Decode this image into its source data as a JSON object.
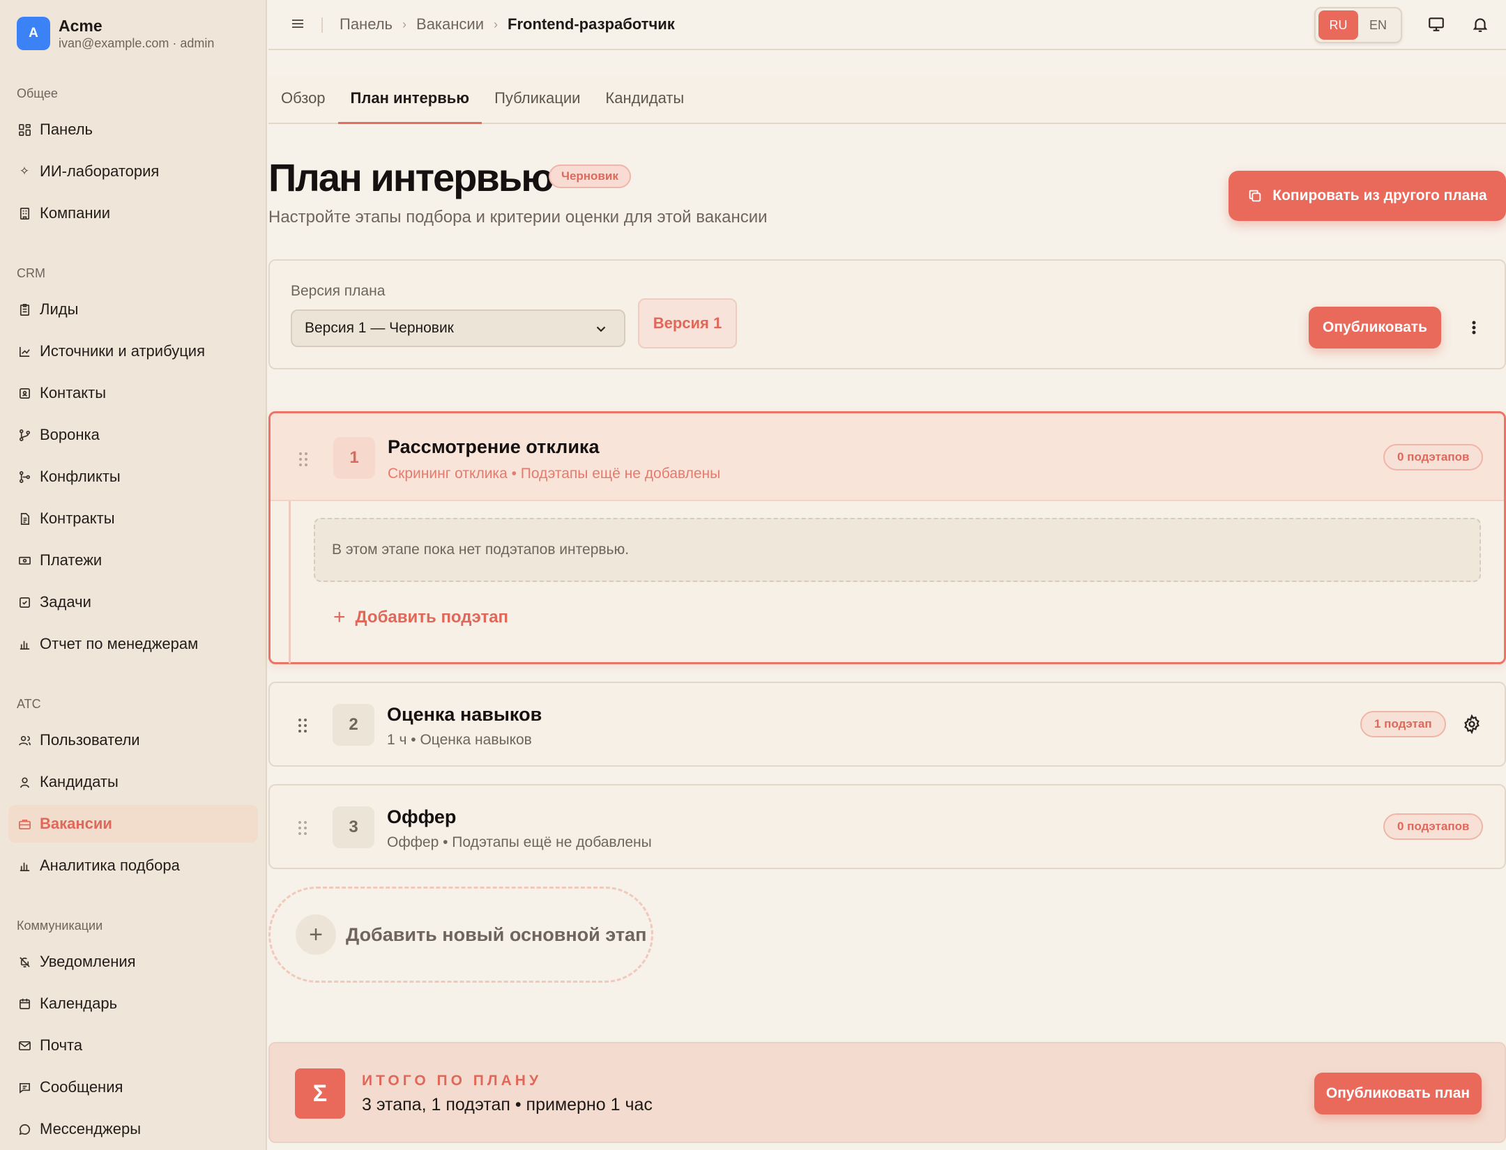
{
  "brand": {
    "initial": "A",
    "name": "Acme",
    "subtitle": "ivan@example.com · admin"
  },
  "sidebar": {
    "groups": [
      {
        "title": "Общее",
        "items": [
          {
            "label": "Панель",
            "icon": "dashboard-icon"
          },
          {
            "label": "ИИ-лаборатория",
            "icon": "sparkles-icon"
          },
          {
            "label": "Компании",
            "icon": "building-icon"
          }
        ]
      },
      {
        "title": "CRM",
        "items": [
          {
            "label": "Лиды",
            "icon": "clipboard-icon"
          },
          {
            "label": "Источники и атрибуция",
            "icon": "chart-line-icon"
          },
          {
            "label": "Контакты",
            "icon": "contact-card-icon"
          },
          {
            "label": "Воронка",
            "icon": "git-branch-icon"
          },
          {
            "label": "Конфликты",
            "icon": "git-fork-icon"
          },
          {
            "label": "Контракты",
            "icon": "document-icon"
          },
          {
            "label": "Платежи",
            "icon": "banknote-icon"
          },
          {
            "label": "Задачи",
            "icon": "checkbox-icon"
          },
          {
            "label": "Отчет по менеджерам",
            "icon": "bar-chart-icon"
          }
        ]
      },
      {
        "title": "ATC",
        "items": [
          {
            "label": "Пользователи",
            "icon": "users-icon"
          },
          {
            "label": "Кандидаты",
            "icon": "user-icon"
          },
          {
            "label": "Вакансии",
            "icon": "briefcase-icon",
            "active": true
          },
          {
            "label": "Аналитика подбора",
            "icon": "bar-chart-icon"
          }
        ]
      },
      {
        "title": "Коммуникации",
        "items": [
          {
            "label": "Уведомления",
            "icon": "bell-off-icon"
          },
          {
            "label": "Календарь",
            "icon": "calendar-icon"
          },
          {
            "label": "Почта",
            "icon": "mail-icon"
          },
          {
            "label": "Сообщения",
            "icon": "message-square-icon"
          },
          {
            "label": "Мессенджеры",
            "icon": "message-circle-icon"
          }
        ]
      }
    ]
  },
  "header": {
    "breadcrumb": [
      "Панель",
      "Вакансии",
      "Frontend-разработчик"
    ],
    "lang": {
      "ru": "RU",
      "en": "EN",
      "active": "RU"
    }
  },
  "tabs": [
    {
      "label": "Обзор"
    },
    {
      "label": "План интервью",
      "active": true
    },
    {
      "label": "Публикации"
    },
    {
      "label": "Кандидаты"
    }
  ],
  "page": {
    "title": "План интервью",
    "status_badge": "Черновик",
    "subtitle": "Настройте этапы подбора и критерии оценки для этой вакансии",
    "copy_button": "Копировать из другого плана"
  },
  "version": {
    "label": "Версия плана",
    "selected": "Версия 1 — Черновик",
    "chip": "Версия 1",
    "publish": "Опубликовать"
  },
  "stages": [
    {
      "num": "1",
      "title": "Рассмотрение отклика",
      "meta": "Скрининг отклика • Подэтапы ещё не добавлены",
      "badge": "0 подэтапов",
      "empty_text": "В этом этапе пока нет подэтапов интервью.",
      "add_sub": "Добавить подэтап"
    },
    {
      "num": "2",
      "title": "Оценка навыков",
      "meta": "1 ч • Оценка навыков",
      "badge": "1 подэтап"
    },
    {
      "num": "3",
      "title": "Оффер",
      "meta": "Оффер • Подэтапы ещё не добавлены",
      "badge": "0 подэтапов"
    }
  ],
  "add_main_stage": "Добавить новый основной этап",
  "summary": {
    "icon": "Σ",
    "title": "ИТОГО ПО ПЛАНУ",
    "text": "3 этапа, 1 подэтап • примерно 1 час",
    "button": "Опубликовать план"
  },
  "colors": {
    "accent": "#e9695b",
    "background": "#f6f1e9",
    "sidebar": "#efe6d9"
  }
}
